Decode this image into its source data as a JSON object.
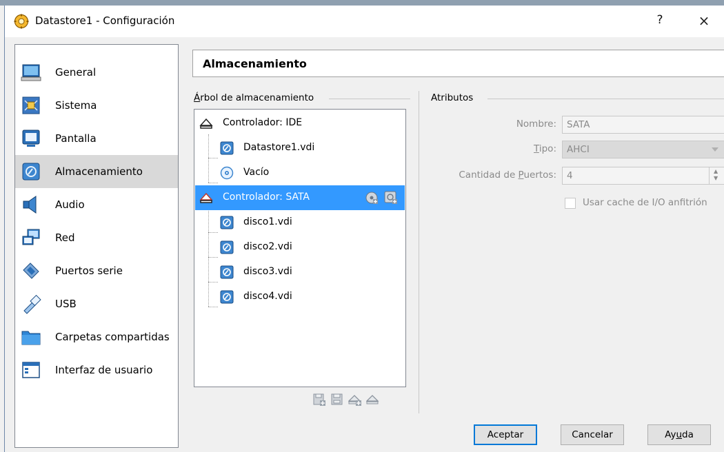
{
  "window": {
    "title": "Datastore1 - Configuración",
    "help_glyph": "?",
    "close_glyph": "×"
  },
  "nav": {
    "items": [
      {
        "label": "General",
        "icon": "monitor-icon"
      },
      {
        "label": "Sistema",
        "icon": "chip-icon"
      },
      {
        "label": "Pantalla",
        "icon": "display-icon"
      },
      {
        "label": "Almacenamiento",
        "icon": "disk-icon",
        "selected": true
      },
      {
        "label": "Audio",
        "icon": "speaker-icon"
      },
      {
        "label": "Red",
        "icon": "network-icon"
      },
      {
        "label": "Puertos serie",
        "icon": "serial-port-icon"
      },
      {
        "label": "USB",
        "icon": "usb-icon"
      },
      {
        "label": "Carpetas compartidas",
        "icon": "folder-icon"
      },
      {
        "label": "Interfaz de usuario",
        "icon": "window-icon"
      }
    ]
  },
  "header": {
    "title": "Almacenamiento"
  },
  "storage_tree": {
    "label_first": "Á",
    "label_rest": "rbol de almacenamiento",
    "rows": [
      {
        "label": "Controlador: IDE",
        "type": "controller"
      },
      {
        "label": "Datastore1.vdi",
        "type": "disk"
      },
      {
        "label": "Vacío",
        "type": "optical"
      },
      {
        "label": "Controlador: SATA",
        "type": "controller",
        "selected": true
      },
      {
        "label": "disco1.vdi",
        "type": "disk"
      },
      {
        "label": "disco2.vdi",
        "type": "disk"
      },
      {
        "label": "disco3.vdi",
        "type": "disk"
      },
      {
        "label": "disco4.vdi",
        "type": "disk"
      }
    ]
  },
  "attributes": {
    "label": "Atributos",
    "name_label": "Nombre:",
    "name_value": "SATA",
    "type_label_pre": "",
    "type_label_key": "T",
    "type_label_post": "ipo:",
    "type_value": "AHCI",
    "ports_label_pre": "Cantidad de ",
    "ports_label_key": "P",
    "ports_label_post": "uertos:",
    "ports_value": "4",
    "cache_label": "Usar cache de I/O anfitrión"
  },
  "buttons": {
    "ok": "Aceptar",
    "cancel": "Cancelar",
    "help_pre": "Ay",
    "help_key": "u",
    "help_post": "da"
  }
}
